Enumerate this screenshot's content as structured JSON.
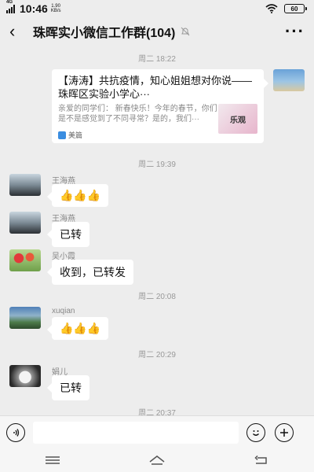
{
  "status_bar": {
    "network": "4G",
    "time": "10:46",
    "speed_value": "1.90",
    "speed_unit": "KB/s",
    "battery": "60"
  },
  "header": {
    "title": "珠晖实小微信工作群(104)"
  },
  "messages": {
    "ts1": "周二 18:22",
    "card": {
      "title": "【涛涛】共抗疫情，知心姐姐想对你说——珠晖区实验小学心···",
      "desc": "亲爱的同学们：  新春快乐！今年的春节，你们是不是感觉到了不同寻常？是的，我们···",
      "image_text": "乐观",
      "source": "美篇"
    },
    "ts2": "周二 19:39",
    "m1_name": "王海燕",
    "m1_text": "👍👍👍",
    "m2_name": "王海燕",
    "m2_text": "已转",
    "m3_name": "吴小霞",
    "m3_text": "收到，已转发",
    "ts3": "周二 20:08",
    "m4_name": "xuqian",
    "m4_text": "👍👍👍",
    "ts4": "周二 20:29",
    "m5_name": "娟儿",
    "m5_text": "已转",
    "ts5": "周二 20:37"
  },
  "colors": {
    "background": "#ededed",
    "bubble": "#ffffff"
  },
  "icons": [
    "back-icon",
    "mute-icon",
    "more-icon",
    "voice-icon",
    "emoji-icon",
    "plus-icon",
    "menu-icon",
    "home-icon",
    "return-icon"
  ]
}
